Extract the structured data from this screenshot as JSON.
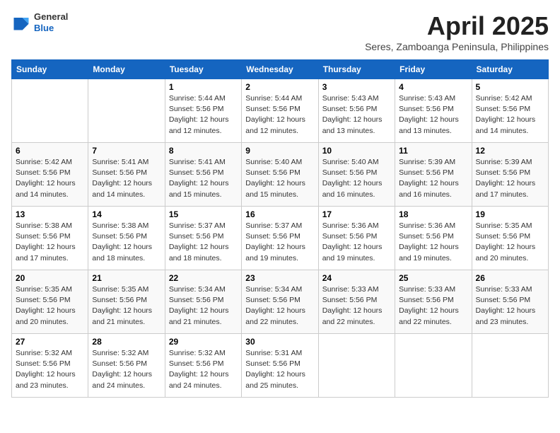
{
  "header": {
    "logo": {
      "general": "General",
      "blue": "Blue"
    },
    "title": "April 2025",
    "subtitle": "Seres, Zamboanga Peninsula, Philippines"
  },
  "weekdays": [
    "Sunday",
    "Monday",
    "Tuesday",
    "Wednesday",
    "Thursday",
    "Friday",
    "Saturday"
  ],
  "weeks": [
    [
      {
        "day": "",
        "info": ""
      },
      {
        "day": "",
        "info": ""
      },
      {
        "day": "1",
        "info": "Sunrise: 5:44 AM\nSunset: 5:56 PM\nDaylight: 12 hours\nand 12 minutes."
      },
      {
        "day": "2",
        "info": "Sunrise: 5:44 AM\nSunset: 5:56 PM\nDaylight: 12 hours\nand 12 minutes."
      },
      {
        "day": "3",
        "info": "Sunrise: 5:43 AM\nSunset: 5:56 PM\nDaylight: 12 hours\nand 13 minutes."
      },
      {
        "day": "4",
        "info": "Sunrise: 5:43 AM\nSunset: 5:56 PM\nDaylight: 12 hours\nand 13 minutes."
      },
      {
        "day": "5",
        "info": "Sunrise: 5:42 AM\nSunset: 5:56 PM\nDaylight: 12 hours\nand 14 minutes."
      }
    ],
    [
      {
        "day": "6",
        "info": "Sunrise: 5:42 AM\nSunset: 5:56 PM\nDaylight: 12 hours\nand 14 minutes."
      },
      {
        "day": "7",
        "info": "Sunrise: 5:41 AM\nSunset: 5:56 PM\nDaylight: 12 hours\nand 14 minutes."
      },
      {
        "day": "8",
        "info": "Sunrise: 5:41 AM\nSunset: 5:56 PM\nDaylight: 12 hours\nand 15 minutes."
      },
      {
        "day": "9",
        "info": "Sunrise: 5:40 AM\nSunset: 5:56 PM\nDaylight: 12 hours\nand 15 minutes."
      },
      {
        "day": "10",
        "info": "Sunrise: 5:40 AM\nSunset: 5:56 PM\nDaylight: 12 hours\nand 16 minutes."
      },
      {
        "day": "11",
        "info": "Sunrise: 5:39 AM\nSunset: 5:56 PM\nDaylight: 12 hours\nand 16 minutes."
      },
      {
        "day": "12",
        "info": "Sunrise: 5:39 AM\nSunset: 5:56 PM\nDaylight: 12 hours\nand 17 minutes."
      }
    ],
    [
      {
        "day": "13",
        "info": "Sunrise: 5:38 AM\nSunset: 5:56 PM\nDaylight: 12 hours\nand 17 minutes."
      },
      {
        "day": "14",
        "info": "Sunrise: 5:38 AM\nSunset: 5:56 PM\nDaylight: 12 hours\nand 18 minutes."
      },
      {
        "day": "15",
        "info": "Sunrise: 5:37 AM\nSunset: 5:56 PM\nDaylight: 12 hours\nand 18 minutes."
      },
      {
        "day": "16",
        "info": "Sunrise: 5:37 AM\nSunset: 5:56 PM\nDaylight: 12 hours\nand 19 minutes."
      },
      {
        "day": "17",
        "info": "Sunrise: 5:36 AM\nSunset: 5:56 PM\nDaylight: 12 hours\nand 19 minutes."
      },
      {
        "day": "18",
        "info": "Sunrise: 5:36 AM\nSunset: 5:56 PM\nDaylight: 12 hours\nand 19 minutes."
      },
      {
        "day": "19",
        "info": "Sunrise: 5:35 AM\nSunset: 5:56 PM\nDaylight: 12 hours\nand 20 minutes."
      }
    ],
    [
      {
        "day": "20",
        "info": "Sunrise: 5:35 AM\nSunset: 5:56 PM\nDaylight: 12 hours\nand 20 minutes."
      },
      {
        "day": "21",
        "info": "Sunrise: 5:35 AM\nSunset: 5:56 PM\nDaylight: 12 hours\nand 21 minutes."
      },
      {
        "day": "22",
        "info": "Sunrise: 5:34 AM\nSunset: 5:56 PM\nDaylight: 12 hours\nand 21 minutes."
      },
      {
        "day": "23",
        "info": "Sunrise: 5:34 AM\nSunset: 5:56 PM\nDaylight: 12 hours\nand 22 minutes."
      },
      {
        "day": "24",
        "info": "Sunrise: 5:33 AM\nSunset: 5:56 PM\nDaylight: 12 hours\nand 22 minutes."
      },
      {
        "day": "25",
        "info": "Sunrise: 5:33 AM\nSunset: 5:56 PM\nDaylight: 12 hours\nand 22 minutes."
      },
      {
        "day": "26",
        "info": "Sunrise: 5:33 AM\nSunset: 5:56 PM\nDaylight: 12 hours\nand 23 minutes."
      }
    ],
    [
      {
        "day": "27",
        "info": "Sunrise: 5:32 AM\nSunset: 5:56 PM\nDaylight: 12 hours\nand 23 minutes."
      },
      {
        "day": "28",
        "info": "Sunrise: 5:32 AM\nSunset: 5:56 PM\nDaylight: 12 hours\nand 24 minutes."
      },
      {
        "day": "29",
        "info": "Sunrise: 5:32 AM\nSunset: 5:56 PM\nDaylight: 12 hours\nand 24 minutes."
      },
      {
        "day": "30",
        "info": "Sunrise: 5:31 AM\nSunset: 5:56 PM\nDaylight: 12 hours\nand 25 minutes."
      },
      {
        "day": "",
        "info": ""
      },
      {
        "day": "",
        "info": ""
      },
      {
        "day": "",
        "info": ""
      }
    ]
  ]
}
